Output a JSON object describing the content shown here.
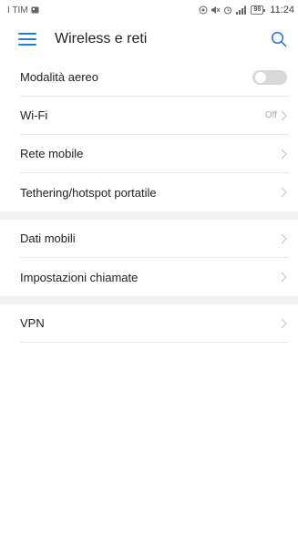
{
  "status_bar": {
    "carrier": "I TIM",
    "battery": "98",
    "time": "11:24"
  },
  "app_bar": {
    "title": "Wireless e reti"
  },
  "sections": [
    {
      "items": [
        {
          "label": "Modalità aereo",
          "type": "toggle",
          "on": false
        },
        {
          "label": "Wi-Fi",
          "type": "value",
          "value": "Off"
        },
        {
          "label": "Rete mobile",
          "type": "link"
        },
        {
          "label": "Tethering/hotspot portatile",
          "type": "link"
        }
      ]
    },
    {
      "items": [
        {
          "label": "Dati mobili",
          "type": "link"
        },
        {
          "label": "Impostazioni chiamate",
          "type": "link"
        }
      ]
    },
    {
      "items": [
        {
          "label": "VPN",
          "type": "link"
        }
      ]
    }
  ],
  "colors": {
    "accent": "#2a7cd9",
    "divider": "#e9e9e9",
    "section_gap": "#f2f2f2",
    "toggle_off": "#d8d8d8"
  }
}
